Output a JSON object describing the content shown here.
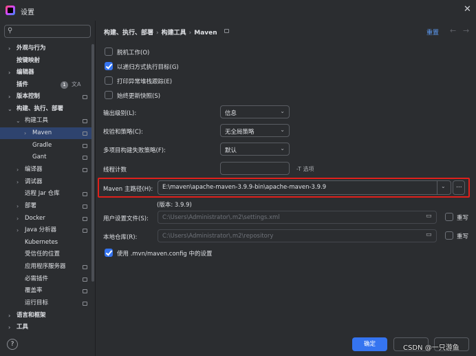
{
  "window": {
    "title": "设置",
    "close_glyph": "✕"
  },
  "sidebar": {
    "search_placeholder": "",
    "badge": "1",
    "items": [
      {
        "label": "外观与行为",
        "bold": true
      },
      {
        "label": "按键映射",
        "bold": true
      },
      {
        "label": "编辑器",
        "bold": true
      },
      {
        "label": "插件",
        "bold": true
      },
      {
        "label": "版本控制",
        "bold": true
      },
      {
        "label": "构建、执行、部署",
        "bold": true
      },
      {
        "label": "构建工具"
      },
      {
        "label": "Maven"
      },
      {
        "label": "Gradle"
      },
      {
        "label": "Gant"
      },
      {
        "label": "编译器"
      },
      {
        "label": "调试器"
      },
      {
        "label": "远程 Jar 仓库"
      },
      {
        "label": "部署"
      },
      {
        "label": "Docker"
      },
      {
        "label": "Java 分析器"
      },
      {
        "label": "Kubernetes"
      },
      {
        "label": "受信任的位置"
      },
      {
        "label": "应用程序服务器"
      },
      {
        "label": "必需插件"
      },
      {
        "label": "覆盖率"
      },
      {
        "label": "运行目标"
      },
      {
        "label": "语言和框架",
        "bold": true
      },
      {
        "label": "工具",
        "bold": true
      }
    ]
  },
  "breadcrumb": {
    "part1": "构建、执行、部署",
    "part2": "构建工具",
    "part3": "Maven",
    "sep": "›"
  },
  "header": {
    "reset": "重置",
    "back": "←",
    "forward": "→"
  },
  "options": {
    "offline": "脱机工作(O)",
    "recursive": "以递归方式执行目标(G)",
    "print_stack": "打印异常堆栈跟踪(E)",
    "always_update": "始终更新快照(S)"
  },
  "form": {
    "output_level_label": "输出级别(L):",
    "output_level_value": "信息",
    "checksum_label": "校验和策略(C):",
    "checksum_value": "无全局策略",
    "failure_label": "多项目构建失败策略(F):",
    "failure_value": "默认",
    "threads_label": "线程计数",
    "threads_hint": "-T 选项",
    "maven_home_label": "Maven 主路径(H):",
    "maven_home_value": "E:\\maven\\apache-maven-3.9.9-bin\\apache-maven-3.9.9",
    "browse": "...",
    "version": "(版本: 3.9.9)",
    "user_settings_label": "用户设置文件(S):",
    "user_settings_value": "C:\\Users\\Administrator\\.m2\\settings.xml",
    "local_repo_label": "本地仓库(R):",
    "local_repo_value": "C:\\Users\\Administrator\\.m2\\repository",
    "override": "重写",
    "use_mvn_config": "使用 .mvn/maven.config 中的设置"
  },
  "footer": {
    "help": "?",
    "ok": "确定",
    "watermark": "CSDN @一只游鱼"
  },
  "colors": {
    "accent": "#3574f0",
    "highlight_box": "#e0201b",
    "link": "#5c9cf6"
  }
}
